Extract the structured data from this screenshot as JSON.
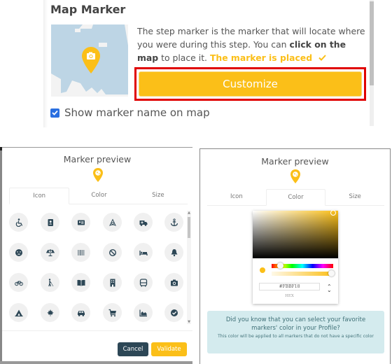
{
  "top_panel": {
    "title": "Map Marker",
    "description_part1": "The step marker is the marker that will locate where you were during this step. You can ",
    "description_bold": "click on the map",
    "description_part2": " to place it. ",
    "placed_status": "The marker is placed",
    "placed_icon": "check-icon",
    "customize_label": "Customize",
    "show_marker_name_label": "Show marker name on map",
    "show_marker_name_checked": true,
    "map_marker_icon": "camera-icon"
  },
  "icon_modal": {
    "title": "Marker preview",
    "preview_icon": "globe-icon",
    "tabs": [
      {
        "label": "Icon",
        "active": true
      },
      {
        "label": "Color",
        "active": false
      },
      {
        "label": "Size",
        "active": false
      }
    ],
    "icons": [
      "wheelchair-icon",
      "address-book-icon",
      "id-card-icon",
      "airbnb-icon",
      "ambulance-icon",
      "anchor-icon",
      "angry-face-icon",
      "balance-scale-icon",
      "barcode-icon",
      "ban-icon",
      "bed-icon",
      "bell-icon",
      "bicycle-icon",
      "blind-person-icon",
      "book-open-icon",
      "building-icon",
      "bus-icon",
      "camera-icon",
      "campground-icon",
      "canadian-maple-leaf-icon",
      "car-icon",
      "shopping-cart-icon",
      "chart-area-icon",
      "check-circle-icon"
    ],
    "cancel_label": "Cancel",
    "validate_label": "Validate"
  },
  "color_modal": {
    "title": "Marker preview",
    "preview_icon": "globe-icon",
    "tabs": [
      {
        "label": "Icon",
        "active": false
      },
      {
        "label": "Color",
        "active": true
      },
      {
        "label": "Size",
        "active": false
      }
    ],
    "picker": {
      "hex_value": "#FBBF18",
      "format_label": "HEX",
      "selected_color": "#fbbf18",
      "alpha": 1.0
    },
    "info_main": "Did you know that you can select your favorite markers' color in your Profile?",
    "info_sub": "This color will be applied to all markers that do not have a specific color"
  },
  "colors": {
    "accent": "#fbbf18",
    "cancel_button": "#2d4756",
    "highlight_border": "#e00000",
    "info_background": "#d4ebee",
    "icon_glyph": "#2d4756"
  }
}
